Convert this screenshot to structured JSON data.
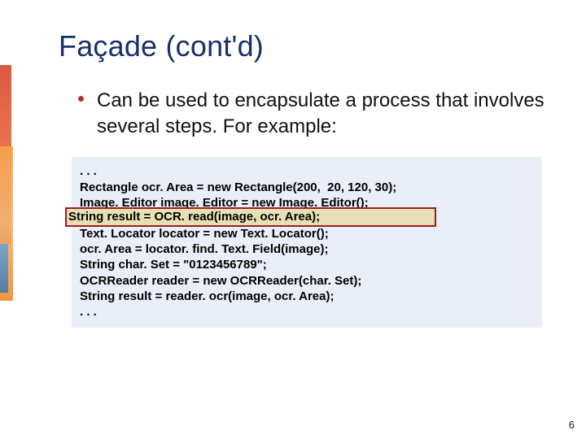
{
  "slide": {
    "title": "Façade (cont'd)",
    "bullet": "Can be used to encapsulate a process that involves several steps.  For example:"
  },
  "code": {
    "line0": ". . .",
    "line1": "Rectangle ocr. Area = new Rectangle(200,  20, 120, 30);",
    "line2": "Image. Editor image. Editor = new Image. Editor();",
    "line3": "String result = OCR. read(image, ocr. Area);",
    "line4": "Text. Locator locator = new Text. Locator();",
    "line5": "ocr. Area = locator. find. Text. Field(image);",
    "line6": "String char. Set = \"0123456789\";",
    "line7": "OCRReader reader = new OCRReader(char. Set);",
    "line8": "String result = reader. ocr(image, ocr. Area);",
    "line9": ". . ."
  },
  "highlight": "String result = OCR. read(image, ocr. Area);",
  "page_number": "6"
}
